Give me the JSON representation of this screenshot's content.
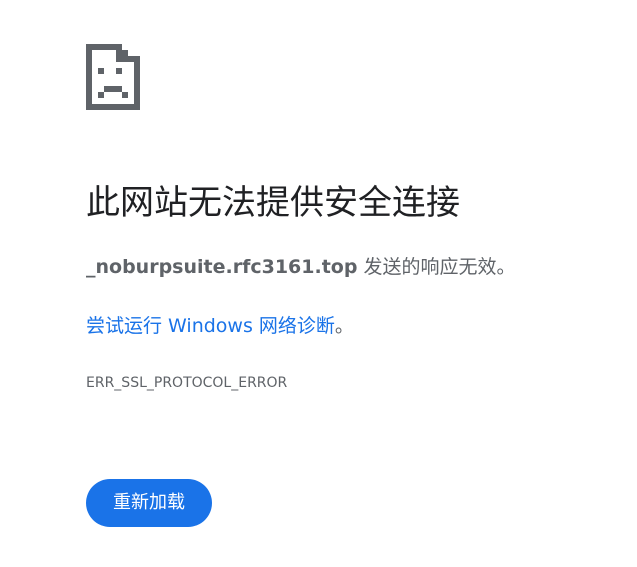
{
  "icon": {
    "name": "sad-page-icon",
    "color": "#5f6368"
  },
  "error": {
    "title": "此网站无法提供安全连接",
    "host": "_noburpsuite.rfc3161.top",
    "summary_suffix": " 发送的响应无效。",
    "suggestion_prefix": "尝试运行 Windows 网络诊断",
    "suggestion_suffix": "。",
    "code": "ERR_SSL_PROTOCOL_ERROR"
  },
  "actions": {
    "reload_label": "重新加载",
    "reload_color": "#1a73e8"
  },
  "colors": {
    "link": "#1a73e8",
    "text": "#202124",
    "secondary_text": "#5f6368"
  }
}
